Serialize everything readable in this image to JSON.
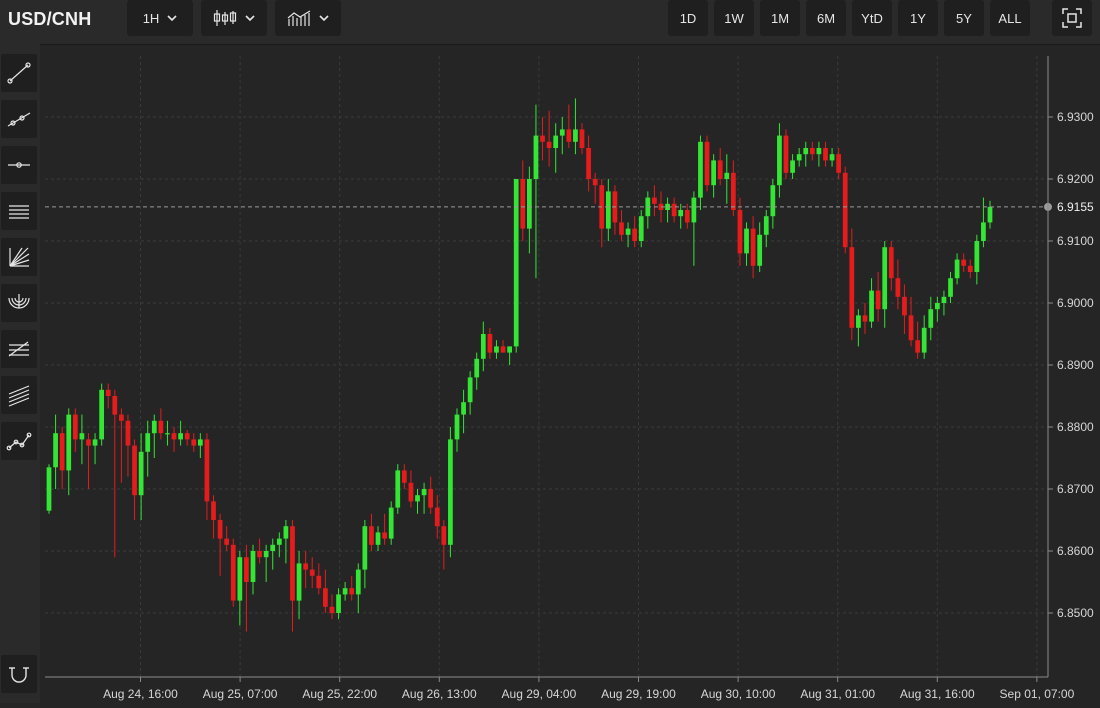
{
  "toolbar": {
    "symbol": "USD/CNH",
    "interval_label": "1H",
    "chart_type_icon": "candlestick-icon",
    "indicators_icon": "indicators-icon",
    "ranges": [
      "1D",
      "1W",
      "1M",
      "6M",
      "YtD",
      "1Y",
      "5Y",
      "ALL"
    ],
    "fullscreen_icon": "fullscreen-icon"
  },
  "sidebar": {
    "tools": [
      "trend-line-icon",
      "ray-icon",
      "horizontal-line-icon",
      "parallel-channel-icon",
      "fan-icon",
      "arc-icon",
      "fib-retracement-icon",
      "fib-channel-icon",
      "path-icon",
      "magnet-icon"
    ]
  },
  "colors": {
    "up": "#33e633",
    "down": "#e61c1c",
    "background": "#252525",
    "grid": "#3a3a3a"
  },
  "chart_data": {
    "type": "candlestick",
    "ylim": [
      6.842,
      6.9345
    ],
    "y_ticks": [
      "6.8500",
      "6.8600",
      "6.8700",
      "6.8800",
      "6.8900",
      "6.9000",
      "6.9100",
      "6.9200",
      "6.9300"
    ],
    "y_tick_values": [
      6.85,
      6.86,
      6.87,
      6.88,
      6.89,
      6.9,
      6.91,
      6.92,
      6.93
    ],
    "x_labels": [
      "Aug 24, 16:00",
      "Aug 25, 07:00",
      "Aug 25, 22:00",
      "Aug 26, 13:00",
      "Aug 29, 04:00",
      "Aug 29, 19:00",
      "Aug 30, 10:00",
      "Aug 31, 01:00",
      "Aug 31, 16:00",
      "Sep 01, 07:00"
    ],
    "last_price": "6.9155",
    "last_price_value": 6.9155,
    "candles": [
      [
        6.8665,
        6.874,
        6.866,
        6.8735
      ],
      [
        6.8735,
        6.882,
        6.87,
        6.879
      ],
      [
        6.879,
        6.88,
        6.87,
        6.873
      ],
      [
        6.873,
        6.883,
        6.869,
        6.882
      ],
      [
        6.882,
        6.883,
        6.876,
        6.878
      ],
      [
        6.878,
        6.882,
        6.874,
        6.879
      ],
      [
        6.878,
        6.879,
        6.87,
        6.877
      ],
      [
        6.877,
        6.879,
        6.874,
        6.878
      ],
      [
        6.878,
        6.887,
        6.877,
        6.886
      ],
      [
        6.886,
        6.887,
        6.883,
        6.885
      ],
      [
        6.885,
        6.886,
        6.859,
        6.882
      ],
      [
        6.882,
        6.883,
        6.871,
        6.881
      ],
      [
        6.881,
        6.882,
        6.872,
        6.877
      ],
      [
        6.877,
        6.878,
        6.865,
        6.869
      ],
      [
        6.869,
        6.879,
        6.865,
        6.876
      ],
      [
        6.876,
        6.881,
        6.872,
        6.879
      ],
      [
        6.879,
        6.882,
        6.875,
        6.881
      ],
      [
        6.881,
        6.883,
        6.878,
        6.879
      ],
      [
        6.879,
        6.881,
        6.877,
        6.879
      ],
      [
        6.879,
        6.88,
        6.876,
        6.878
      ],
      [
        6.878,
        6.881,
        6.877,
        6.879
      ],
      [
        6.879,
        6.8795,
        6.877,
        6.878
      ],
      [
        6.878,
        6.879,
        6.876,
        6.877
      ],
      [
        6.877,
        6.879,
        6.875,
        6.878
      ],
      [
        6.878,
        6.879,
        6.865,
        6.868
      ],
      [
        6.868,
        6.869,
        6.862,
        6.865
      ],
      [
        6.865,
        6.866,
        6.856,
        6.862
      ],
      [
        6.862,
        6.864,
        6.86,
        6.861
      ],
      [
        6.861,
        6.862,
        6.851,
        6.852
      ],
      [
        6.852,
        6.86,
        6.848,
        6.859
      ],
      [
        6.859,
        6.861,
        6.847,
        6.855
      ],
      [
        6.855,
        6.861,
        6.853,
        6.86
      ],
      [
        6.86,
        6.862,
        6.858,
        6.859
      ],
      [
        6.859,
        6.861,
        6.855,
        6.86
      ],
      [
        6.86,
        6.862,
        6.857,
        6.861
      ],
      [
        6.861,
        6.863,
        6.859,
        6.862
      ],
      [
        6.862,
        6.865,
        6.858,
        6.864
      ],
      [
        6.864,
        6.865,
        6.847,
        6.852
      ],
      [
        6.852,
        6.86,
        6.849,
        6.858
      ],
      [
        6.858,
        6.86,
        6.854,
        6.857
      ],
      [
        6.857,
        6.859,
        6.854,
        6.856
      ],
      [
        6.856,
        6.858,
        6.853,
        6.854
      ],
      [
        6.854,
        6.857,
        6.85,
        6.851
      ],
      [
        6.851,
        6.853,
        6.849,
        6.85
      ],
      [
        6.85,
        6.854,
        6.849,
        6.853
      ],
      [
        6.853,
        6.855,
        6.852,
        6.854
      ],
      [
        6.854,
        6.856,
        6.852,
        6.853
      ],
      [
        6.853,
        6.858,
        6.85,
        6.857
      ],
      [
        6.857,
        6.865,
        6.854,
        6.864
      ],
      [
        6.864,
        6.866,
        6.86,
        6.861
      ],
      [
        6.861,
        6.864,
        6.86,
        6.863
      ],
      [
        6.863,
        6.866,
        6.861,
        6.862
      ],
      [
        6.862,
        6.868,
        6.861,
        6.867
      ],
      [
        6.867,
        6.874,
        6.866,
        6.873
      ],
      [
        6.873,
        6.874,
        6.87,
        6.871
      ],
      [
        6.871,
        6.873,
        6.867,
        6.868
      ],
      [
        6.868,
        6.87,
        6.866,
        6.869
      ],
      [
        6.869,
        6.871,
        6.866,
        6.87
      ],
      [
        6.87,
        6.872,
        6.866,
        6.867
      ],
      [
        6.867,
        6.869,
        6.862,
        6.864
      ],
      [
        6.864,
        6.865,
        6.857,
        6.861
      ],
      [
        6.861,
        6.88,
        6.859,
        6.878
      ],
      [
        6.878,
        6.883,
        6.876,
        6.882
      ],
      [
        6.882,
        6.886,
        6.879,
        6.884
      ],
      [
        6.884,
        6.889,
        6.882,
        6.888
      ],
      [
        6.888,
        6.892,
        6.886,
        6.891
      ],
      [
        6.891,
        6.897,
        6.889,
        6.895
      ],
      [
        6.895,
        6.896,
        6.891,
        6.892
      ],
      [
        6.892,
        6.894,
        6.891,
        6.893
      ],
      [
        6.893,
        6.894,
        6.892,
        6.892
      ],
      [
        6.892,
        6.893,
        6.89,
        6.893
      ],
      [
        6.893,
        6.92,
        6.892,
        6.92
      ],
      [
        6.92,
        6.923,
        6.91,
        6.912
      ],
      [
        6.912,
        6.922,
        6.908,
        6.92
      ],
      [
        6.92,
        6.932,
        6.904,
        6.927
      ],
      [
        6.927,
        6.93,
        6.923,
        6.926
      ],
      [
        6.926,
        6.931,
        6.922,
        6.925
      ],
      [
        6.925,
        6.929,
        6.921,
        6.927
      ],
      [
        6.927,
        6.93,
        6.924,
        6.928
      ],
      [
        6.928,
        6.932,
        6.925,
        6.926
      ],
      [
        6.926,
        6.933,
        6.924,
        6.928
      ],
      [
        6.928,
        6.929,
        6.924,
        6.925
      ],
      [
        6.925,
        6.927,
        6.918,
        6.92
      ],
      [
        6.92,
        6.921,
        6.916,
        6.919
      ],
      [
        6.919,
        6.92,
        6.909,
        6.912
      ],
      [
        6.912,
        6.92,
        6.91,
        6.918
      ],
      [
        6.918,
        6.919,
        6.911,
        6.913
      ],
      [
        6.913,
        6.915,
        6.91,
        6.911
      ],
      [
        6.911,
        6.913,
        6.909,
        6.912
      ],
      [
        6.912,
        6.914,
        6.909,
        6.91
      ],
      [
        6.91,
        6.915,
        6.909,
        6.914
      ],
      [
        6.914,
        6.918,
        6.912,
        6.917
      ],
      [
        6.917,
        6.919,
        6.914,
        6.916
      ],
      [
        6.916,
        6.918,
        6.913,
        6.915
      ],
      [
        6.915,
        6.917,
        6.913,
        6.916
      ],
      [
        6.916,
        6.917,
        6.913,
        6.914
      ],
      [
        6.914,
        6.916,
        6.912,
        6.915
      ],
      [
        6.915,
        6.916,
        6.912,
        6.913
      ],
      [
        6.913,
        6.918,
        6.906,
        6.917
      ],
      [
        6.917,
        6.927,
        6.915,
        6.926
      ],
      [
        6.926,
        6.927,
        6.918,
        6.919
      ],
      [
        6.919,
        6.924,
        6.917,
        6.923
      ],
      [
        6.923,
        6.925,
        6.919,
        6.92
      ],
      [
        6.92,
        6.924,
        6.916,
        6.921
      ],
      [
        6.921,
        6.923,
        6.914,
        6.915
      ],
      [
        6.915,
        6.917,
        6.906,
        6.908
      ],
      [
        6.908,
        6.913,
        6.906,
        6.912
      ],
      [
        6.912,
        6.914,
        6.904,
        6.906
      ],
      [
        6.906,
        6.913,
        6.905,
        6.911
      ],
      [
        6.911,
        6.915,
        6.909,
        6.914
      ],
      [
        6.914,
        6.92,
        6.912,
        6.919
      ],
      [
        6.919,
        6.929,
        6.917,
        6.927
      ],
      [
        6.927,
        6.928,
        6.92,
        6.921
      ],
      [
        6.921,
        6.924,
        6.92,
        6.923
      ],
      [
        6.923,
        6.925,
        6.922,
        6.924
      ],
      [
        6.924,
        6.926,
        6.922,
        6.925
      ],
      [
        6.925,
        6.926,
        6.923,
        6.924
      ],
      [
        6.924,
        6.926,
        6.922,
        6.925
      ],
      [
        6.925,
        6.926,
        6.922,
        6.923
      ],
      [
        6.923,
        6.925,
        6.922,
        6.924
      ],
      [
        6.924,
        6.925,
        6.92,
        6.921
      ],
      [
        6.921,
        6.922,
        6.908,
        6.909
      ],
      [
        6.909,
        6.912,
        6.894,
        6.896
      ],
      [
        6.896,
        6.899,
        6.893,
        6.898
      ],
      [
        6.898,
        6.9,
        6.895,
        6.897
      ],
      [
        6.897,
        6.904,
        6.896,
        6.902
      ],
      [
        6.902,
        6.905,
        6.897,
        6.899
      ],
      [
        6.899,
        6.91,
        6.896,
        6.909
      ],
      [
        6.909,
        6.91,
        6.902,
        6.904
      ],
      [
        6.904,
        6.907,
        6.899,
        6.901
      ],
      [
        6.901,
        6.903,
        6.895,
        6.898
      ],
      [
        6.898,
        6.901,
        6.893,
        6.894
      ],
      [
        6.894,
        6.897,
        6.891,
        6.892
      ],
      [
        6.892,
        6.898,
        6.891,
        6.896
      ],
      [
        6.896,
        6.901,
        6.894,
        6.899
      ],
      [
        6.899,
        6.901,
        6.897,
        6.9
      ],
      [
        6.9,
        6.902,
        6.898,
        6.901
      ],
      [
        6.901,
        6.905,
        6.9,
        6.904
      ],
      [
        6.904,
        6.908,
        6.903,
        6.907
      ],
      [
        6.907,
        6.908,
        6.905,
        6.906
      ],
      [
        6.906,
        6.907,
        6.904,
        6.905
      ],
      [
        6.905,
        6.911,
        6.903,
        6.91
      ],
      [
        6.91,
        6.917,
        6.909,
        6.913
      ],
      [
        6.913,
        6.9165,
        6.912,
        6.9155
      ]
    ]
  }
}
